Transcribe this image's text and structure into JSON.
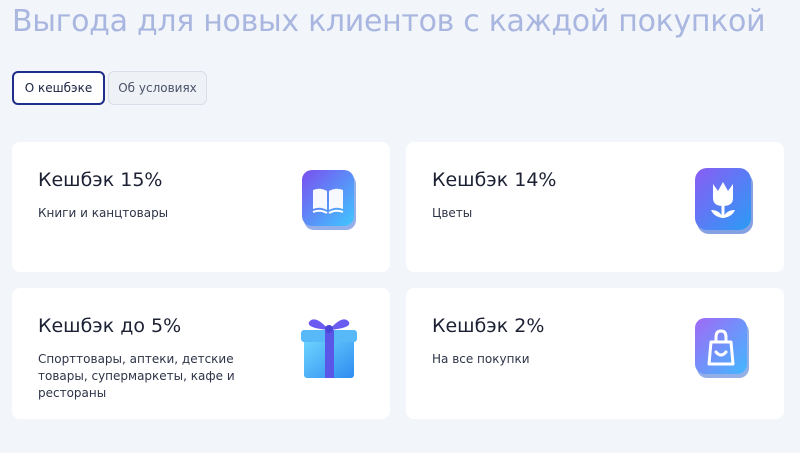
{
  "headline": "Выгода для новых клиентов с каждой покупкой",
  "tabs": [
    {
      "label": "О кешбэке",
      "active": true
    },
    {
      "label": "Об условиях",
      "active": false
    }
  ],
  "cards": [
    {
      "title": "Кешбэк 15%",
      "description": "Книги и канцтовары",
      "icon": "book-icon"
    },
    {
      "title": "Кешбэк 14%",
      "description": "Цветы",
      "icon": "tulip-icon"
    },
    {
      "title": "Кешбэк до 5%",
      "description": "Спорттовары, аптеки, детские товары, супермаркеты, кафе и рестораны",
      "icon": "gift-box-icon"
    },
    {
      "title": "Кешбэк 2%",
      "description": "На все покупки",
      "icon": "shopping-bag-icon"
    }
  ],
  "colors": {
    "background": "#f2f5f9",
    "headline": "#a9b6e0",
    "active_tab_border": "#1f2e8a",
    "icon_gradient_start": "#6a5cf2",
    "icon_gradient_end": "#3fc1ff"
  }
}
